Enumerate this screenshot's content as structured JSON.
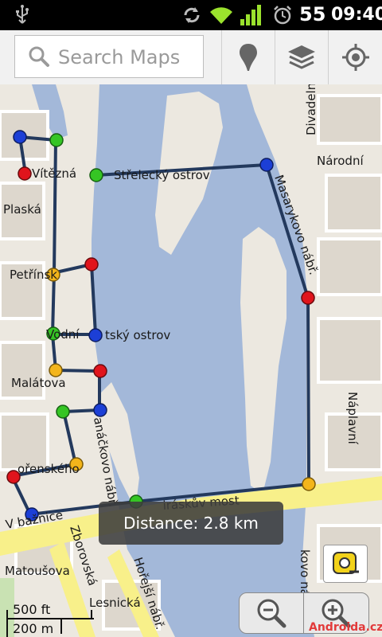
{
  "statusbar": {
    "battery": "55",
    "time": "09:40",
    "icons": [
      "usb-icon",
      "sync-icon",
      "wifi-icon",
      "signal-icon",
      "alarm-icon"
    ]
  },
  "toolbar": {
    "search_placeholder": "Search Maps",
    "buttons": [
      "places-pin-icon",
      "layers-icon",
      "my-location-icon"
    ]
  },
  "map": {
    "labels": {
      "vitezna": "Vítězná",
      "strelecky": "Střelecký ostrov",
      "divadelni": "Divadelní",
      "narodni": "Národní",
      "plaska": "Plaská",
      "masarykovo": "Masarykovo nábř.",
      "petrinska": "Petřínsk",
      "vodni": "Vodní",
      "detsky": "tský ostrov",
      "malatova": "Malátova",
      "janackovo": "anáčkovo nábř.",
      "korenskeho": "ořenského",
      "jiraskuv": "iráskův most",
      "vbaznice": "V bažnice",
      "zborovska": "Zborovská",
      "matousova": "Matoušova",
      "lesnicka": "Lesnická",
      "hore_nabr": "Hořejší nábř.",
      "naplavni": "Náplavní",
      "masaryk_nabr_south": "kovo nábř."
    },
    "colors": {
      "water": "#a3b8d9",
      "land": "#ece8e0",
      "park": "#c9e2b3",
      "major_road": "#f8f08a",
      "route": "#23395d"
    }
  },
  "distance_toast": "Distance:  2.8 km",
  "scale": {
    "feet": "500 ft",
    "meters": "200 m"
  },
  "watermark": "Androida.cz"
}
